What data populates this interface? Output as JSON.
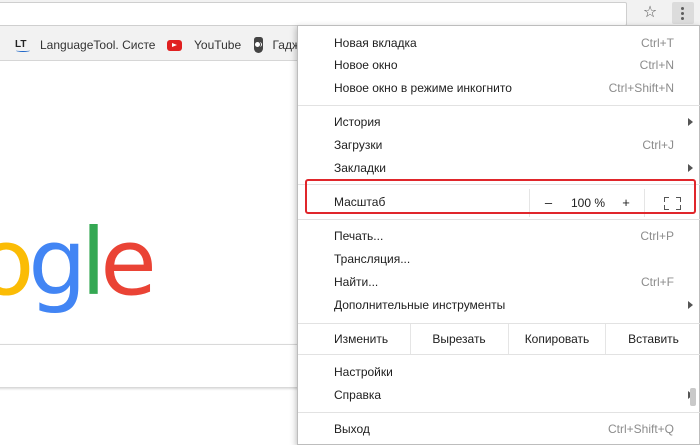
{
  "bookmarks": [
    {
      "label": "LanguageTool. Систе",
      "icon": "languagetool-icon"
    },
    {
      "label": "YouTube",
      "icon": "youtube-icon"
    },
    {
      "label": "Гадж",
      "icon": "owl-icon"
    }
  ],
  "bookmark_icon_text": "LT",
  "logo": {
    "letters": [
      "o",
      "g",
      "l",
      "e"
    ]
  },
  "menu": {
    "new_tab": {
      "label": "Новая вкладка",
      "shortcut": "Ctrl+T"
    },
    "new_window": {
      "label": "Новое окно",
      "shortcut": "Ctrl+N"
    },
    "incognito": {
      "label": "Новое окно в режиме инкогнито",
      "shortcut": "Ctrl+Shift+N"
    },
    "history": {
      "label": "История"
    },
    "downloads": {
      "label": "Загрузки",
      "shortcut": "Ctrl+J"
    },
    "bookmarks": {
      "label": "Закладки"
    },
    "zoom": {
      "label": "Масштаб",
      "minus": "–",
      "value": "100 %",
      "plus": "+"
    },
    "print": {
      "label": "Печать...",
      "shortcut": "Ctrl+P"
    },
    "cast": {
      "label": "Трансляция..."
    },
    "find": {
      "label": "Найти...",
      "shortcut": "Ctrl+F"
    },
    "more_tools": {
      "label": "Дополнительные инструменты"
    },
    "edit": {
      "label": "Изменить",
      "cut": "Вырезать",
      "copy": "Копировать",
      "paste": "Вставить"
    },
    "settings": {
      "label": "Настройки"
    },
    "help": {
      "label": "Справка"
    },
    "exit": {
      "label": "Выход",
      "shortcut": "Ctrl+Shift+Q"
    }
  },
  "colors": {
    "highlight": "#e0262b",
    "google_blue": "#4285f4",
    "google_red": "#ea4335",
    "google_yellow": "#fbbc05",
    "google_green": "#34a853"
  }
}
